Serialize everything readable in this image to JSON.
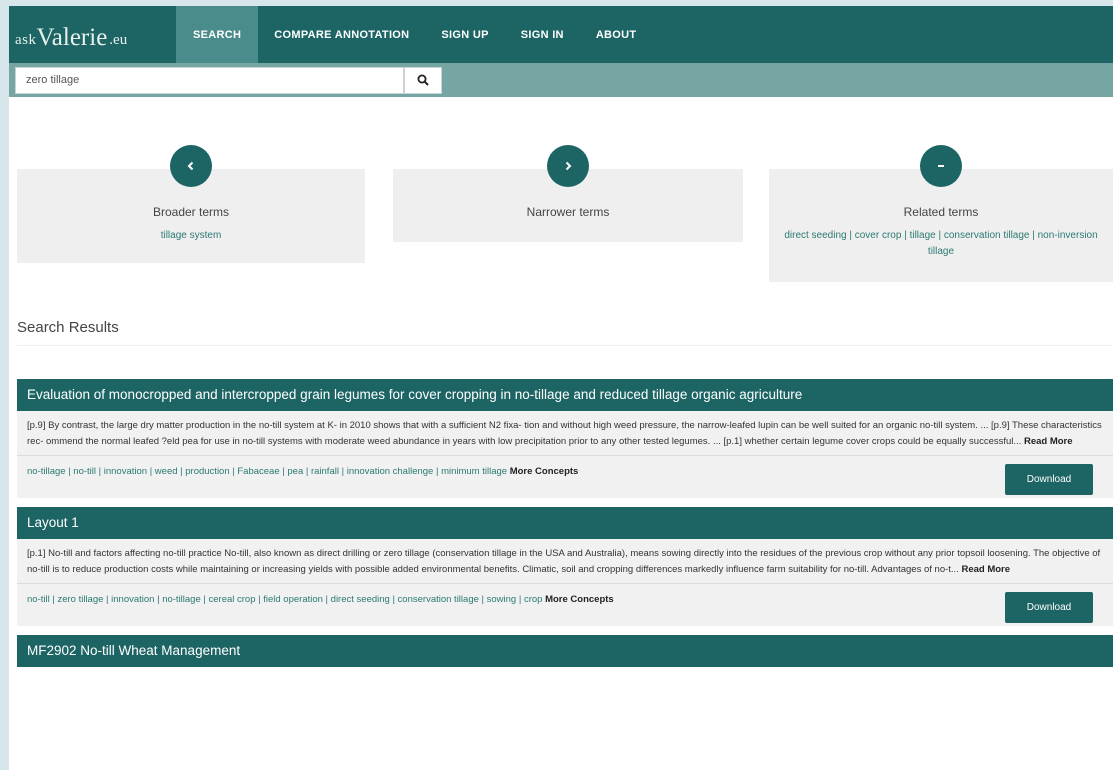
{
  "logo": {
    "prefix": "ask",
    "name": "Valerie",
    "suffix": ".eu"
  },
  "nav": {
    "items": [
      {
        "label": "SEARCH"
      },
      {
        "label": "COMPARE ANNOTATION"
      },
      {
        "label": "SIGN UP"
      },
      {
        "label": "SIGN IN"
      },
      {
        "label": "ABOUT"
      }
    ]
  },
  "search": {
    "value": "zero tillage",
    "placeholder": ""
  },
  "terms": {
    "broader": {
      "title": "Broader terms",
      "links": "tillage system"
    },
    "narrower": {
      "title": "Narrower terms",
      "links": ""
    },
    "related": {
      "title": "Related terms",
      "links": "direct seeding | cover crop | tillage | conservation tillage | non-inversion tillage"
    }
  },
  "results_title": "Search Results",
  "results": [
    {
      "title": "Evaluation of monocropped and intercropped grain legumes for cover cropping in no-tillage and reduced tillage organic agriculture",
      "snippet": "[p.9] By contrast, the large dry matter production in the no-till system at K- in 2010 shows that with a sufficient N2 fixa- tion and without high weed pressure, the narrow-leafed lupin can be well suited for an organic no-till system. ... [p.9] These characteristics rec- ommend the normal leafed ?eld pea for use in no-till systems with moderate weed abundance in years with low precipitation prior to any other tested legumes. ... [p.1] whether certain legume cover crops could be equally successful...",
      "read_more": "Read More",
      "concepts": "no-tillage | no-till | innovation | weed | production | Fabaceae | pea | rainfall | innovation challenge | minimum tillage",
      "more_concepts": "More Concepts",
      "download": "Download"
    },
    {
      "title": "Layout 1",
      "snippet": "[p.1] No-till and factors affecting no-till practice No-till, also known as direct drilling or zero tillage (conservation tillage in the USA and Australia), means sowing directly into the residues of the previous crop without any prior topsoil loosening. The objective of no-till is to reduce production costs while maintaining or increasing yields with possible added environmental benefits. Climatic, soil and cropping differences markedly influence farm suitability for no-till. Advantages of no-t...",
      "read_more": "Read More",
      "concepts": "no-till | zero tillage | innovation | no-tillage | cereal crop | field operation | direct seeding | conservation tillage | sowing | crop",
      "more_concepts": "More Concepts",
      "download": "Download"
    },
    {
      "title": "MF2902 No-till Wheat Management"
    }
  ]
}
